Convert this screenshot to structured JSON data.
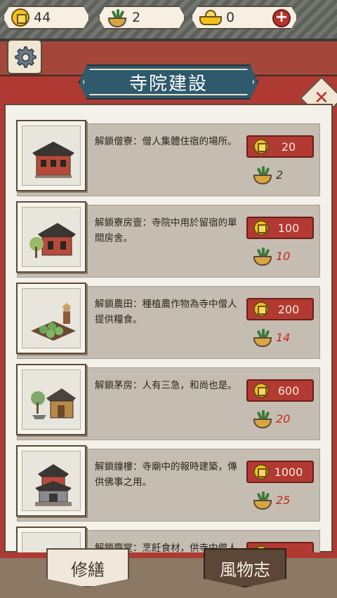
{
  "currency": {
    "coins": "44",
    "bowls": "2",
    "ingots": "0",
    "add_label": "+"
  },
  "panel": {
    "title": "寺院建設",
    "close_label": "✕"
  },
  "items": [
    {
      "description": "解鎖僧寮：僧人集體住宿的場所。",
      "coin_cost": "20",
      "bowl_cost": "2",
      "bowl_sufficient": true
    },
    {
      "description": "解鎖寮房壹：寺院中用於留宿的單間房舍。",
      "coin_cost": "100",
      "bowl_cost": "10",
      "bowl_sufficient": false
    },
    {
      "description": "解鎖農田：種植農作物為寺中僧人提供糧食。",
      "coin_cost": "200",
      "bowl_cost": "14",
      "bowl_sufficient": false
    },
    {
      "description": "解鎖茅房：人有三急，和尚也是。",
      "coin_cost": "600",
      "bowl_cost": "20",
      "bowl_sufficient": false
    },
    {
      "description": "解鎖鐘樓：寺廟中的報時建築，傳供佛事之用。",
      "coin_cost": "1000",
      "bowl_cost": "25",
      "bowl_sufficient": false
    },
    {
      "description": "解鎖齋堂：烹飪食材，供寺中僧人",
      "coin_cost": "",
      "bowl_cost": "",
      "bowl_sufficient": false
    }
  ],
  "tabs": {
    "repair": "修繕",
    "annals": "風物志"
  },
  "colors": {
    "accent_red": "#b23a32",
    "banner_blue": "#2f5a6c",
    "insufficient_red": "#c8281f"
  }
}
